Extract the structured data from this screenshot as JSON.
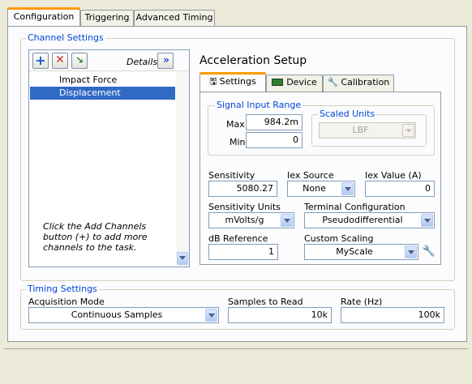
{
  "tabs": [
    "Configuration",
    "Triggering",
    "Advanced Timing"
  ],
  "channel_settings": {
    "title": "Channel Settings",
    "details_label": "Details",
    "channels": [
      "Impact Force",
      "Displacement"
    ],
    "selected_index": 1,
    "hint": "Click the Add Channels button (+) to add more channels to the task.",
    "setup_title": "Acceleration Setup",
    "subtabs": [
      "Settings",
      "Device",
      "Calibration"
    ],
    "signal_input_range": {
      "title": "Signal Input Range",
      "max_label": "Max",
      "max_value": "984.2m",
      "min_label": "Min",
      "min_value": "0"
    },
    "scaled_units": {
      "title": "Scaled Units",
      "value": "LBF"
    },
    "sensitivity": {
      "label": "Sensitivity",
      "value": "5080.27"
    },
    "iex_source": {
      "label": "Iex Source",
      "value": "None"
    },
    "iex_value": {
      "label": "Iex Value (A)",
      "value": "0"
    },
    "sensitivity_units": {
      "label": "Sensitivity Units",
      "value": "mVolts/g"
    },
    "terminal_configuration": {
      "label": "Terminal Configuration",
      "value": "Pseudodifferential"
    },
    "db_reference": {
      "label": "dB Reference",
      "value": "1"
    },
    "custom_scaling": {
      "label": "Custom Scaling",
      "value": "MyScale"
    }
  },
  "timing_settings": {
    "title": "Timing Settings",
    "acquisition_mode": {
      "label": "Acquisition Mode",
      "value": "Continuous Samples"
    },
    "samples_to_read": {
      "label": "Samples to Read",
      "value": "10k"
    },
    "rate": {
      "label": "Rate (Hz)",
      "value": "100k"
    }
  }
}
